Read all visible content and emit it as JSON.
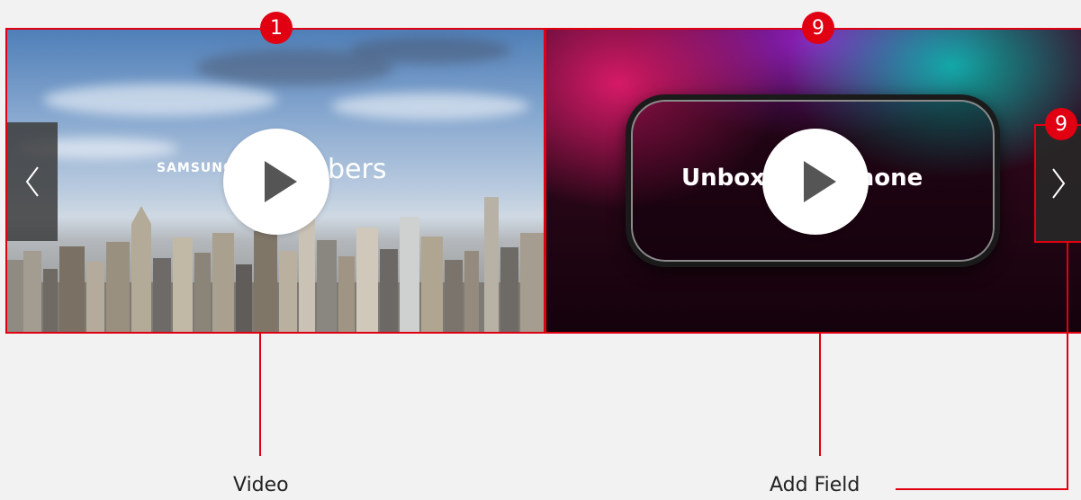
{
  "badges": {
    "video": "1",
    "add_field": "9",
    "next_arrow": "9"
  },
  "tiles": [
    {
      "brand": "SAMSUNG",
      "title_word": "bers"
    },
    {
      "title": "Unbox your phone"
    }
  ],
  "nav": {
    "prev": "‹",
    "next": "›"
  },
  "captions": {
    "video": "Video",
    "add_field": "Add Field"
  },
  "colors": {
    "callout_red": "#e00012",
    "background": "#f2f2f2"
  }
}
